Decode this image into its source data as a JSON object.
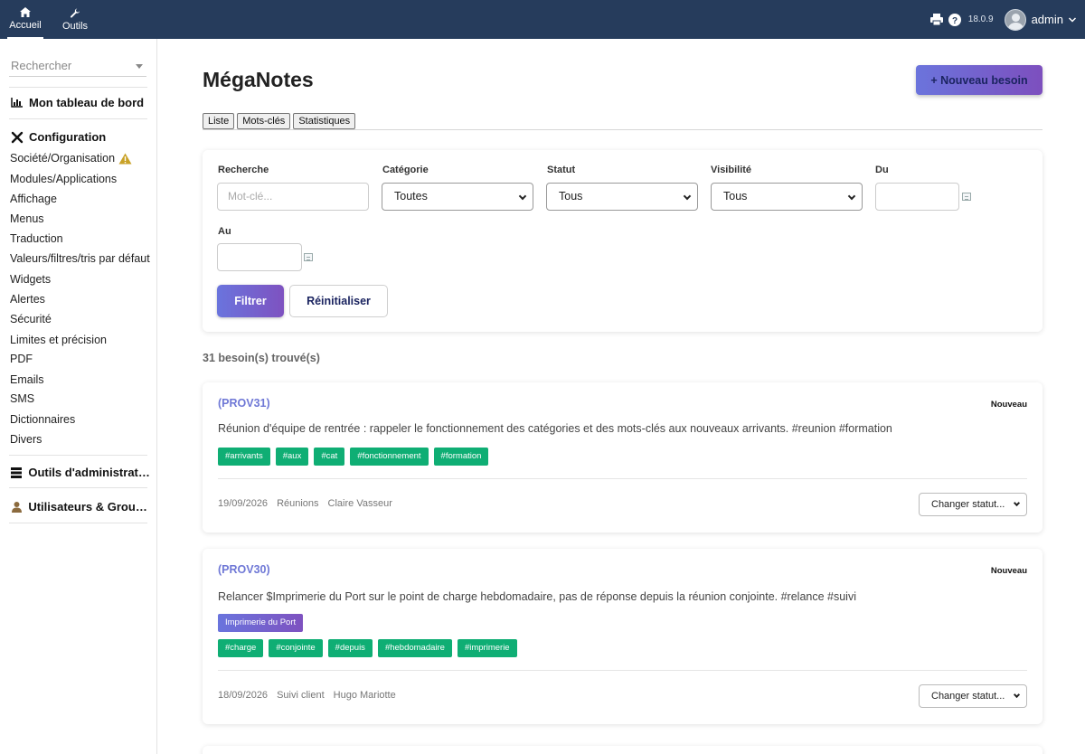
{
  "topbar": {
    "nav": [
      {
        "label": "Accueil",
        "icon": "home-icon"
      },
      {
        "label": "Outils",
        "icon": "wrench-icon"
      }
    ],
    "version": "18.0.9",
    "user": "admin",
    "bg_color": "#263c5c"
  },
  "sidebar": {
    "search_placeholder": "Rechercher",
    "dashboard": "Mon tableau de bord",
    "configuration": "Configuration",
    "config_items": [
      "Société/Organisation",
      "Modules/Applications",
      "Affichage",
      "Menus",
      "Traduction",
      "Valeurs/filtres/tris par défaut",
      "Widgets",
      "Alertes",
      "Sécurité",
      "Limites et précision",
      "PDF",
      "Emails",
      "SMS",
      "Dictionnaires",
      "Divers"
    ],
    "admin_tools": "Outils d'administration",
    "users_groups": "Utilisateurs & Groupes"
  },
  "main": {
    "title": "MégaNotes",
    "new_button": "+ Nouveau besoin",
    "tabs": [
      "Liste",
      "Mots-clés",
      "Statistiques"
    ],
    "filters": {
      "search_label": "Recherche",
      "search_placeholder": "Mot-clé...",
      "category_label": "Catégorie",
      "category_value": "Toutes",
      "status_label": "Statut",
      "status_value": "Tous",
      "visibility_label": "Visibilité",
      "visibility_value": "Tous",
      "from_label": "Du",
      "to_label": "Au",
      "filter_button": "Filtrer",
      "reset_button": "Réinitialiser"
    },
    "count_text": "31 besoin(s) trouvé(s)",
    "cards": [
      {
        "ref": "(PROV31)",
        "status": "Nouveau",
        "text": "Réunion d'équipe de rentrée : rappeler le fonctionnement des catégories et des mots-clés aux nouveaux arrivants. #reunion #formation",
        "entity_tags": [],
        "tags": [
          "#arrivants",
          "#aux",
          "#cat",
          "#fonctionnement",
          "#formation"
        ],
        "date": "19/09/2026",
        "category": "Réunions",
        "author": "Claire Vasseur",
        "status_select": "Changer statut..."
      },
      {
        "ref": "(PROV30)",
        "status": "Nouveau",
        "text": "Relancer $Imprimerie du Port sur le point de charge hebdomadaire, pas de réponse depuis la réunion conjointe. #relance #suivi",
        "entity_tags": [
          "Imprimerie du Port"
        ],
        "tags": [
          "#charge",
          "#conjointe",
          "#depuis",
          "#hebdomadaire",
          "#imprimerie"
        ],
        "date": "18/09/2026",
        "category": "Suivi client",
        "author": "Hugo Mariotte",
        "status_select": "Changer statut..."
      }
    ]
  }
}
